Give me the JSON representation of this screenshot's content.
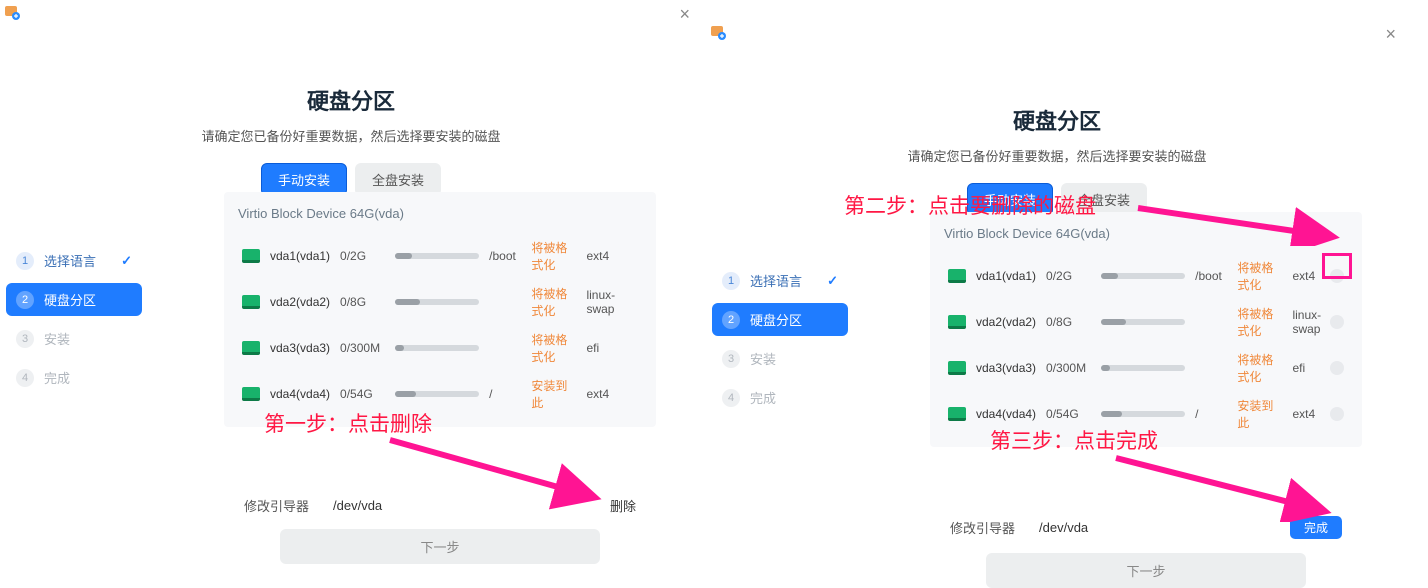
{
  "shared": {
    "title": "硬盘分区",
    "subtitle": "请确定您已备份好重要数据，然后选择要安装的磁盘",
    "tabs": {
      "manual": "手动安装",
      "full": "全盘安装"
    },
    "disk_title": "Virtio Block Device 64G(vda)",
    "sidebar": {
      "s1": {
        "num": "1",
        "label": "选择语言"
      },
      "s2": {
        "num": "2",
        "label": "硬盘分区"
      },
      "s3": {
        "num": "3",
        "label": "安装"
      },
      "s4": {
        "num": "4",
        "label": "完成"
      }
    },
    "partitions": [
      {
        "name": "vda1(vda1)",
        "size": "0/2G",
        "mount": "/boot",
        "status": "将被格式化",
        "fs": "ext4"
      },
      {
        "name": "vda2(vda2)",
        "size": "0/8G",
        "mount": "",
        "status": "将被格式化",
        "fs": "linux-swap"
      },
      {
        "name": "vda3(vda3)",
        "size": "0/300M",
        "mount": "",
        "status": "将被格式化",
        "fs": "efi"
      },
      {
        "name": "vda4(vda4)",
        "size": "0/54G",
        "mount": "/",
        "status": "安装到此",
        "fs": "ext4"
      }
    ],
    "boot": {
      "label": "修改引导器",
      "value": "/dev/vda"
    },
    "next": "下一步",
    "delete": "删除",
    "done": "完成"
  },
  "annotations": {
    "step1": "第一步：点击删除",
    "step2": "第二步：点击要删除的磁盘",
    "step3": "第三步：点击完成"
  }
}
